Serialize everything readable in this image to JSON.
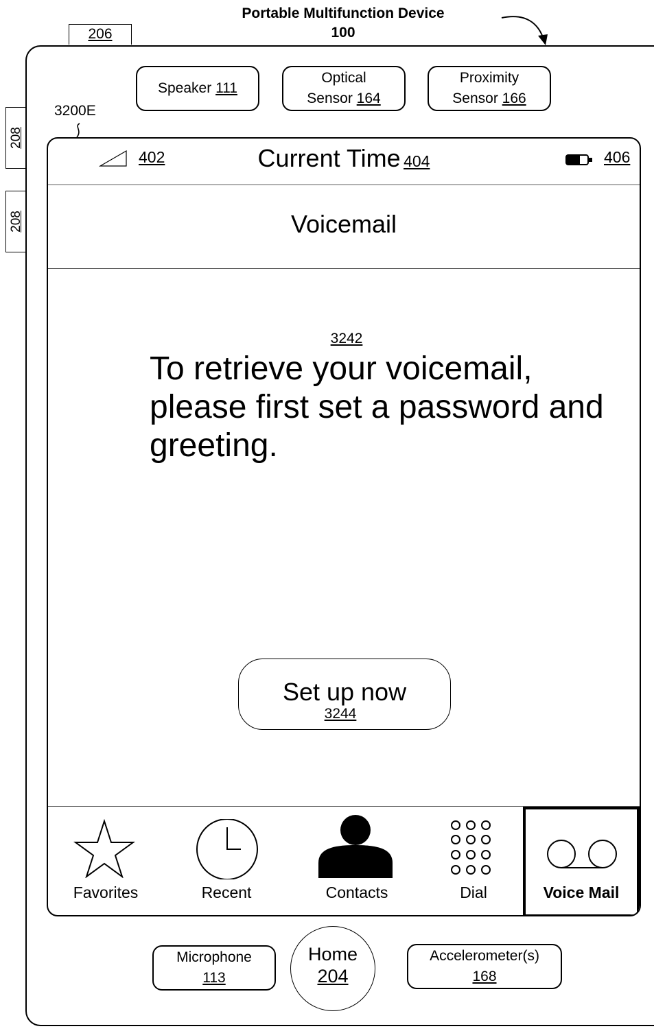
{
  "header": {
    "title_line1": "Portable Multifunction Device",
    "title_line2": "100"
  },
  "ref_labels": {
    "button_206": "206",
    "side_button_top": "208",
    "side_button_bottom": "208",
    "screen_ref": "3200E"
  },
  "sensors_top": [
    {
      "line1": "Speaker",
      "ref": "111"
    },
    {
      "line1": "Optical",
      "line2": "Sensor",
      "ref": "164"
    },
    {
      "line1": "Proximity",
      "line2": "Sensor",
      "ref": "166"
    }
  ],
  "status_bar": {
    "signal_ref": "402",
    "time_label": "Current Time",
    "time_ref": "404",
    "battery_ref": "406"
  },
  "nav": {
    "title": "Voicemail"
  },
  "message": {
    "ref": "3242",
    "text": "To retrieve your voicemail, please first set a password and greeting."
  },
  "setup_button": {
    "label": "Set up now",
    "ref": "3244"
  },
  "tabs": [
    {
      "label": "Favorites",
      "icon": "star-icon"
    },
    {
      "label": "Recent",
      "icon": "clock-icon"
    },
    {
      "label": "Contacts",
      "icon": "person-icon"
    },
    {
      "label": "Dial",
      "icon": "keypad-icon"
    },
    {
      "label": "Voice Mail",
      "icon": "voicemail-icon",
      "selected": true
    }
  ],
  "sensors_bottom": [
    {
      "line1": "Microphone",
      "ref": "113"
    },
    {
      "line1": "Home",
      "ref": "204"
    },
    {
      "line1": "Accelerometer(s)",
      "ref": "168"
    }
  ]
}
